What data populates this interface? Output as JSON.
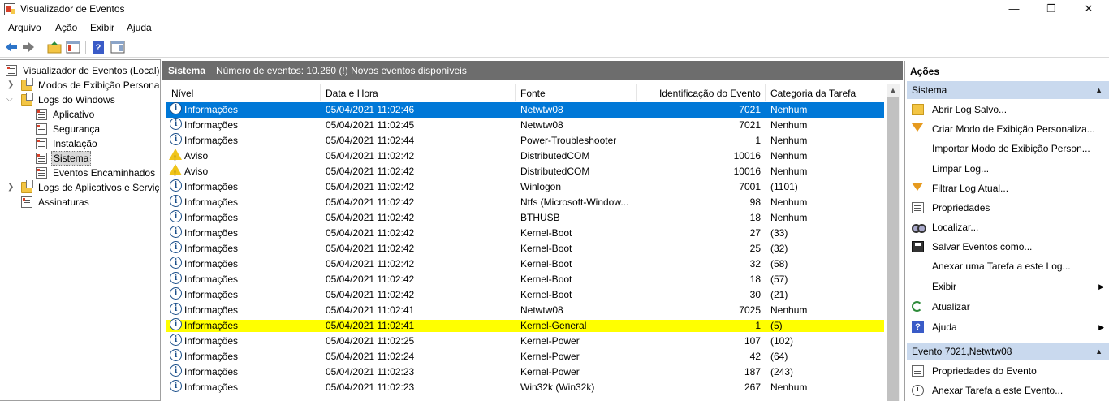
{
  "window": {
    "title": "Visualizador de Eventos",
    "minimize": "—",
    "maximize": "❐",
    "close": "✕"
  },
  "menu": [
    "Arquivo",
    "Ação",
    "Exibir",
    "Ajuda"
  ],
  "tree": [
    {
      "label": "Visualizador de Eventos (Local)",
      "icon": "event-viewer-icon"
    },
    {
      "label": "Modos de Exibição Personalizados",
      "icon": "folder-icon"
    },
    {
      "label": "Logs do Windows",
      "icon": "folder-icon"
    },
    {
      "label": "Aplicativo",
      "icon": "log-icon"
    },
    {
      "label": "Segurança",
      "icon": "log-icon"
    },
    {
      "label": "Instalação",
      "icon": "log-icon"
    },
    {
      "label": "Sistema",
      "icon": "log-icon"
    },
    {
      "label": "Eventos Encaminhados",
      "icon": "log-icon"
    },
    {
      "label": "Logs de Aplicativos e Serviços",
      "icon": "folder-icon"
    },
    {
      "label": "Assinaturas",
      "icon": "subscriptions-icon"
    }
  ],
  "center": {
    "log_name": "Sistema",
    "info": "Número de eventos: 10.260 (!) Novos eventos disponíveis",
    "columns": [
      "Nível",
      "Data e Hora",
      "Fonte",
      "Identificação do Evento",
      "Categoria da Tarefa"
    ],
    "rows": [
      {
        "level": "Informações",
        "type": "info",
        "date": "05/04/2021 11:02:46",
        "source": "Netwtw08",
        "id": "7021",
        "category": "Nenhum"
      },
      {
        "level": "Informações",
        "type": "info",
        "date": "05/04/2021 11:02:45",
        "source": "Netwtw08",
        "id": "7021",
        "category": "Nenhum"
      },
      {
        "level": "Informações",
        "type": "info",
        "date": "05/04/2021 11:02:44",
        "source": "Power-Troubleshooter",
        "id": "1",
        "category": "Nenhum"
      },
      {
        "level": "Aviso",
        "type": "warning",
        "date": "05/04/2021 11:02:42",
        "source": "DistributedCOM",
        "id": "10016",
        "category": "Nenhum"
      },
      {
        "level": "Aviso",
        "type": "warning",
        "date": "05/04/2021 11:02:42",
        "source": "DistributedCOM",
        "id": "10016",
        "category": "Nenhum"
      },
      {
        "level": "Informações",
        "type": "info",
        "date": "05/04/2021 11:02:42",
        "source": "Winlogon",
        "id": "7001",
        "category": "(1101)"
      },
      {
        "level": "Informações",
        "type": "info",
        "date": "05/04/2021 11:02:42",
        "source": "Ntfs (Microsoft-Window...",
        "id": "98",
        "category": "Nenhum"
      },
      {
        "level": "Informações",
        "type": "info",
        "date": "05/04/2021 11:02:42",
        "source": "BTHUSB",
        "id": "18",
        "category": "Nenhum"
      },
      {
        "level": "Informações",
        "type": "info",
        "date": "05/04/2021 11:02:42",
        "source": "Kernel-Boot",
        "id": "27",
        "category": "(33)"
      },
      {
        "level": "Informações",
        "type": "info",
        "date": "05/04/2021 11:02:42",
        "source": "Kernel-Boot",
        "id": "25",
        "category": "(32)"
      },
      {
        "level": "Informações",
        "type": "info",
        "date": "05/04/2021 11:02:42",
        "source": "Kernel-Boot",
        "id": "32",
        "category": "(58)"
      },
      {
        "level": "Informações",
        "type": "info",
        "date": "05/04/2021 11:02:42",
        "source": "Kernel-Boot",
        "id": "18",
        "category": "(57)"
      },
      {
        "level": "Informações",
        "type": "info",
        "date": "05/04/2021 11:02:42",
        "source": "Kernel-Boot",
        "id": "30",
        "category": "(21)"
      },
      {
        "level": "Informações",
        "type": "info",
        "date": "05/04/2021 11:02:41",
        "source": "Netwtw08",
        "id": "7025",
        "category": "Nenhum"
      },
      {
        "level": "Informações",
        "type": "info",
        "date": "05/04/2021 11:02:41",
        "source": "Kernel-General",
        "id": "1",
        "category": "(5)"
      },
      {
        "level": "Informações",
        "type": "info",
        "date": "05/04/2021 11:02:25",
        "source": "Kernel-Power",
        "id": "107",
        "category": "(102)"
      },
      {
        "level": "Informações",
        "type": "info",
        "date": "05/04/2021 11:02:24",
        "source": "Kernel-Power",
        "id": "42",
        "category": "(64)"
      },
      {
        "level": "Informações",
        "type": "info",
        "date": "05/04/2021 11:02:23",
        "source": "Kernel-Power",
        "id": "187",
        "category": "(243)"
      },
      {
        "level": "Informações",
        "type": "info",
        "date": "05/04/2021 11:02:23",
        "source": "Win32k (Win32k)",
        "id": "267",
        "category": "Nenhum"
      }
    ]
  },
  "actions": {
    "title": "Ações",
    "section1": "Sistema",
    "items1": [
      {
        "label": "Abrir Log Salvo...",
        "icon": "open-folder-icon"
      },
      {
        "label": "Criar Modo de Exibição Personaliza...",
        "icon": "filter-icon"
      },
      {
        "label": "Importar Modo de Exibição Person...",
        "icon": ""
      },
      {
        "label": "Limpar Log...",
        "icon": ""
      },
      {
        "label": "Filtrar Log Atual...",
        "icon": "filter-icon"
      },
      {
        "label": "Propriedades",
        "icon": "properties-icon"
      },
      {
        "label": "Localizar...",
        "icon": "binoculars-icon"
      },
      {
        "label": "Salvar Eventos como...",
        "icon": "save-icon"
      },
      {
        "label": "Anexar uma Tarefa a este Log...",
        "icon": ""
      },
      {
        "label": "Exibir",
        "icon": "",
        "submenu": true
      },
      {
        "label": "Atualizar",
        "icon": "refresh-icon"
      },
      {
        "label": "Ajuda",
        "icon": "help-icon",
        "submenu": true
      }
    ],
    "section2": "Evento 7021,Netwtw08",
    "items2": [
      {
        "label": "Propriedades do Evento",
        "icon": "properties-icon"
      },
      {
        "label": "Anexar Tarefa a este Evento...",
        "icon": "task-icon"
      }
    ]
  }
}
